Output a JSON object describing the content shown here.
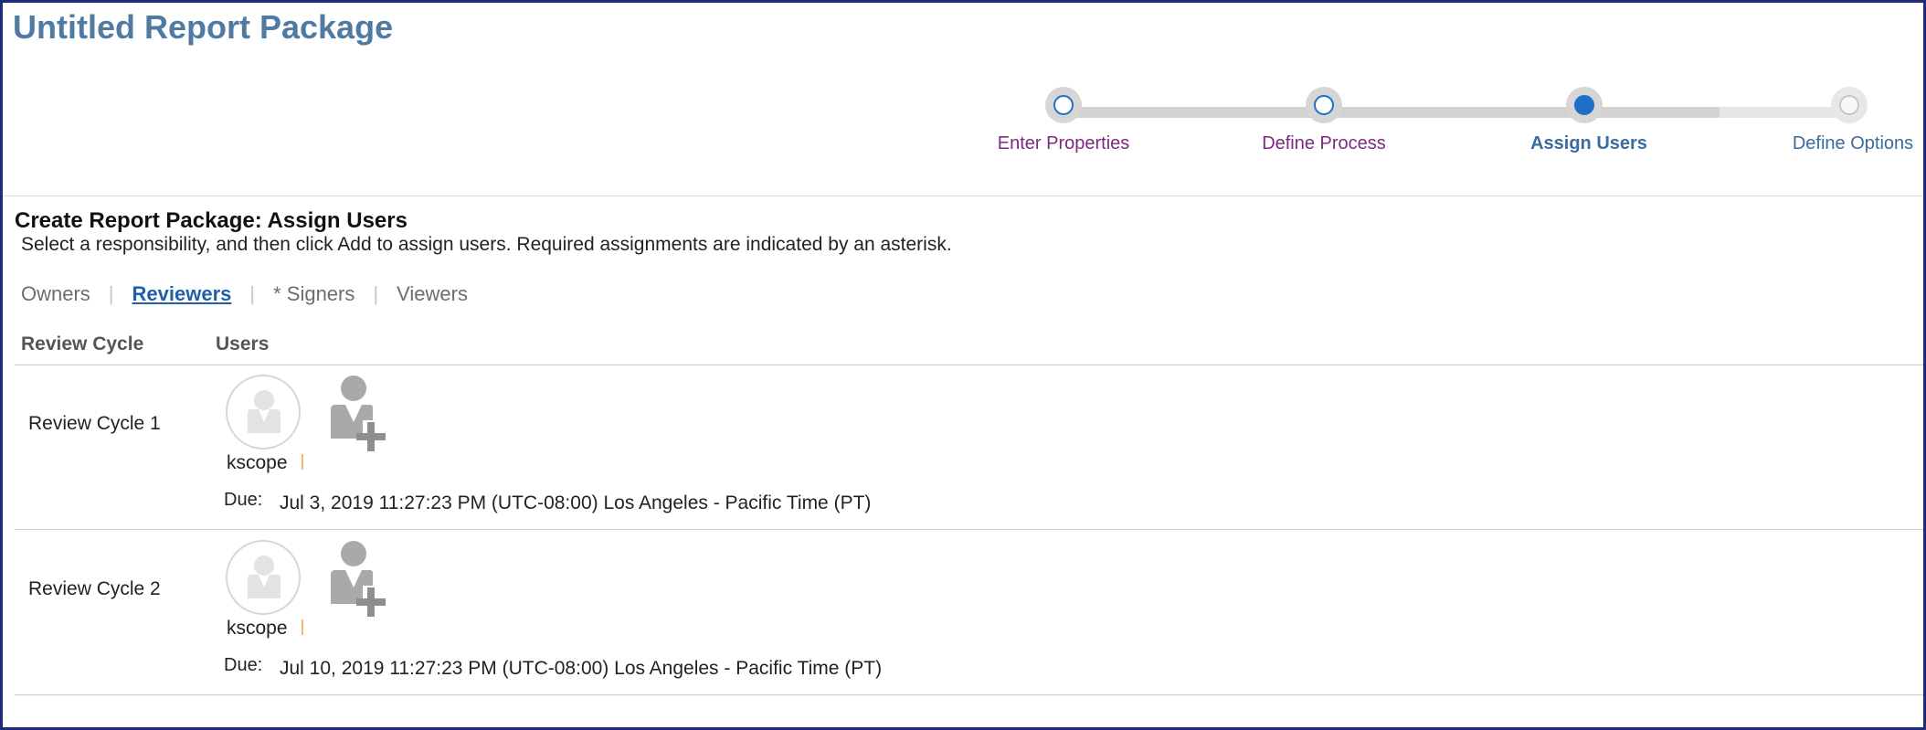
{
  "app": {
    "title": "Untitled Report Package"
  },
  "train": {
    "steps": [
      {
        "label": "Enter Properties",
        "state": "visited"
      },
      {
        "label": "Define Process",
        "state": "visited"
      },
      {
        "label": "Assign Users",
        "state": "current"
      },
      {
        "label": "Define Options",
        "state": "future"
      }
    ]
  },
  "page": {
    "title": "Create Report Package: Assign Users",
    "instructions": "Select a responsibility, and then click Add to assign users. Required assignments are indicated by an asterisk."
  },
  "tabs": [
    {
      "label": "Owners",
      "active": false
    },
    {
      "label": "Reviewers",
      "active": true
    },
    {
      "label": "* Signers",
      "active": false
    },
    {
      "label": "Viewers",
      "active": false
    }
  ],
  "table": {
    "headers": {
      "review_cycle": "Review Cycle",
      "users": "Users"
    },
    "rows": [
      {
        "cycle": "Review Cycle 1",
        "user": "kscope",
        "due_label": "Due:",
        "due": "Jul 3, 2019 11:27:23 PM (UTC-08:00) Los Angeles - Pacific Time (PT)"
      },
      {
        "cycle": "Review Cycle 2",
        "user": "kscope",
        "due_label": "Due:",
        "due": "Jul 10, 2019 11:27:23 PM (UTC-08:00) Los Angeles - Pacific Time (PT)"
      }
    ]
  },
  "colors": {
    "title": "#4f7ba3",
    "frame_border": "#1f2a7a",
    "train_active": "#1e6fc8",
    "visited_label": "#7b2a7f",
    "active_tab": "#1f5fa8"
  },
  "icons": {
    "avatar": "user-avatar-icon",
    "add_user": "add-user-icon"
  }
}
